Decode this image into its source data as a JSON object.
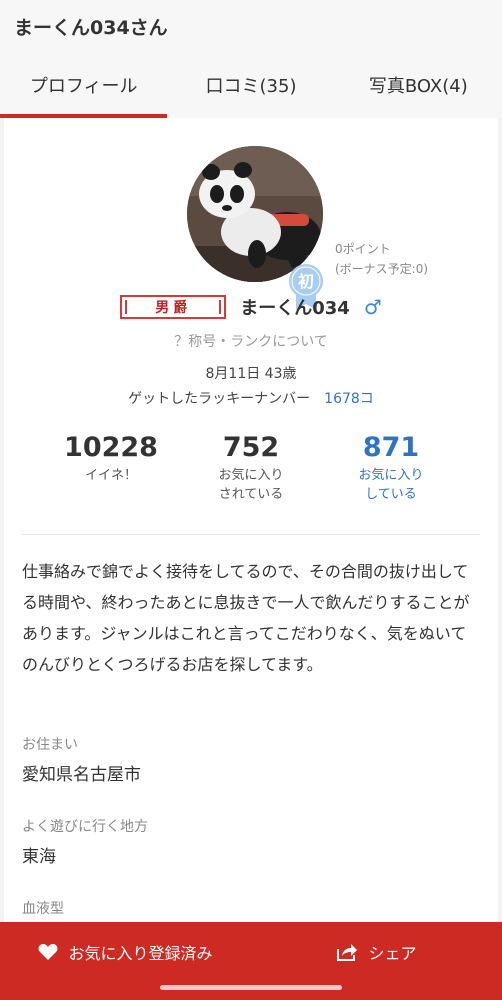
{
  "header": {
    "title": "まーくん034さん"
  },
  "tabs": [
    {
      "label": "プロフィール"
    },
    {
      "label": "口コミ(35)"
    },
    {
      "label": "写真BOX(4)"
    }
  ],
  "profile": {
    "badge_text": "初",
    "points": "0ポイント",
    "bonus": "(ボーナス予定:0)",
    "rank_title": "男爵",
    "username": "まーくん034",
    "gender_icon": "male-icon",
    "rank_help": "？称号・ランクについて",
    "birthday": "8月11日 43歳",
    "lucky_label": "ゲットしたラッキーナンバー",
    "lucky_count": "1678コ"
  },
  "stats": [
    {
      "value": "10228",
      "label1": "イイネ！",
      "label2": ""
    },
    {
      "value": "752",
      "label1": "お気に入り",
      "label2": "されている"
    },
    {
      "value": "871",
      "label1": "お気に入り",
      "label2": "している"
    }
  ],
  "bio": "仕事絡みで錦でよく接待をしてるので、その合間の抜け出してる時間や、終わったあとに息抜きで一人で飲んだりすることがあります。ジャンルはこれと言ってこだわりなく、気をぬいてのんびりとくつろげるお店を探してます。",
  "fields": {
    "residence_label": "お住まい",
    "residence_value": "愛知県名古屋市",
    "area_label": "よく遊びに行く地方",
    "area_value": "東海",
    "blood_label": "血液型"
  },
  "bottom": {
    "favorite_label": "お気に入り登録済み",
    "share_label": "シェア"
  },
  "colors": {
    "accent": "#cc2a22",
    "link": "#2f74c0",
    "badge": "#a9cdf0"
  }
}
